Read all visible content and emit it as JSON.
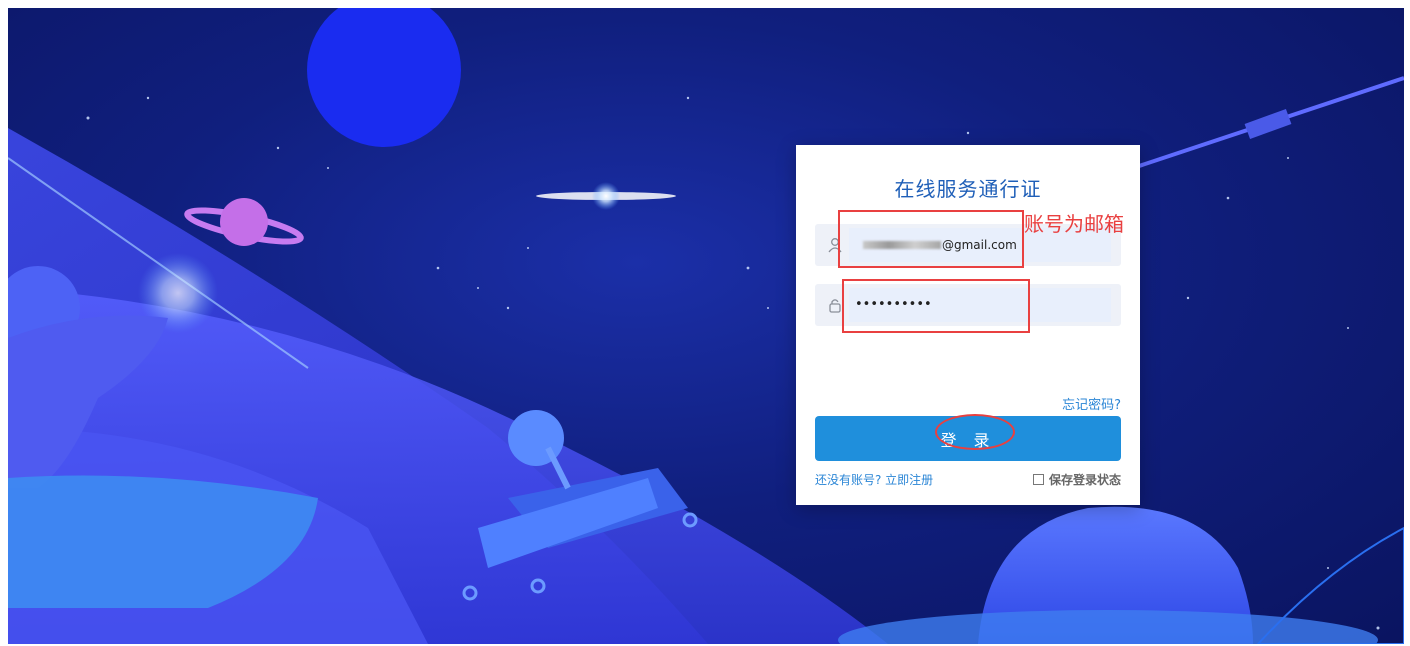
{
  "login": {
    "title": "在线服务通行证",
    "email_value": "@gmail.com",
    "password_value": "••••••••••",
    "forgot_label": "忘记密码?",
    "login_label": "登 录",
    "register_label": "还没有账号? 立即注册",
    "remember_label": "保存登录状态"
  },
  "annotations": {
    "account_note": "账号为邮箱"
  },
  "colors": {
    "accent": "#1f8fdc",
    "link": "#2b86d6",
    "annotation": "#e94040",
    "title": "#1f5fb8"
  },
  "icons": [
    "user-icon",
    "lock-icon",
    "checkbox-icon"
  ]
}
